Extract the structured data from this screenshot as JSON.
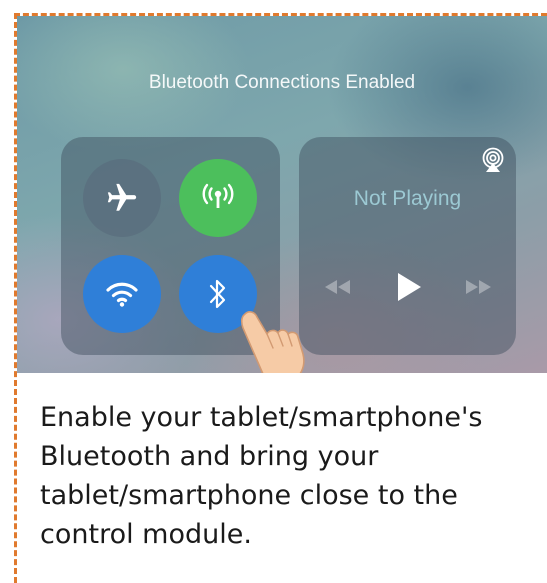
{
  "status": {
    "message": "Bluetooth Connections Enabled"
  },
  "connectivity": {
    "airplane": {
      "icon": "airplane-icon",
      "state": "off",
      "color": "#5a6e7d"
    },
    "cellular": {
      "icon": "cellular-antenna-icon",
      "state": "on",
      "color": "#4cbf5c"
    },
    "wifi": {
      "icon": "wifi-icon",
      "state": "on",
      "color": "#2f7fd8"
    },
    "bluetooth": {
      "icon": "bluetooth-icon",
      "state": "on",
      "color": "#2f7fd8"
    }
  },
  "media": {
    "now_playing": "Not Playing",
    "icons": [
      "airplay-icon",
      "rewind-icon",
      "play-icon",
      "fast-forward-icon"
    ]
  },
  "instruction": {
    "text": "Enable your tablet/smartphone's Bluetooth and bring your tablet/smartphone close to the control module."
  },
  "colors": {
    "border_dash": "#e07a2e",
    "caption_text": "#1a1a1a"
  }
}
